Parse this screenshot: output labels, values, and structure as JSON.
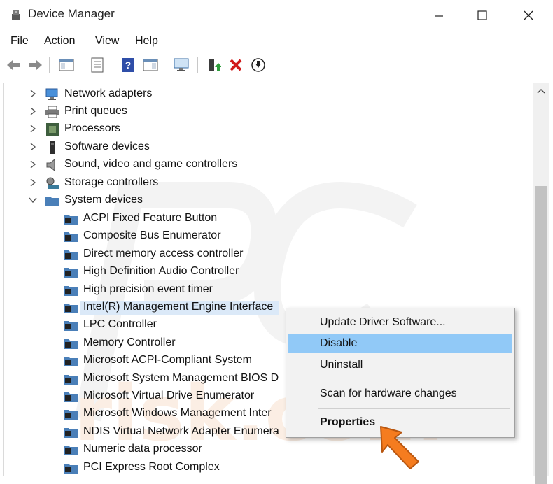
{
  "window": {
    "title": "Device Manager"
  },
  "menubar": {
    "items": [
      "File",
      "Action",
      "View",
      "Help"
    ]
  },
  "toolbar": {
    "buttons": [
      "back-icon",
      "forward-icon",
      "show-hide-console-tree-icon",
      "properties-icon",
      "help-icon",
      "action-pane-icon",
      "monitor-icon",
      "update-driver-icon",
      "uninstall-icon",
      "disable-icon"
    ]
  },
  "tree": {
    "categories": [
      {
        "label": "Network adapters",
        "expanded": false
      },
      {
        "label": "Print queues",
        "expanded": false
      },
      {
        "label": "Processors",
        "expanded": false
      },
      {
        "label": "Software devices",
        "expanded": false
      },
      {
        "label": "Sound, video and game controllers",
        "expanded": false
      },
      {
        "label": "Storage controllers",
        "expanded": false
      },
      {
        "label": "System devices",
        "expanded": true
      }
    ],
    "system_devices": [
      "ACPI Fixed Feature Button",
      "Composite Bus Enumerator",
      "Direct memory access controller",
      "High Definition Audio Controller",
      "High precision event timer",
      "Intel(R) Management Engine Interface",
      "LPC Controller",
      "Memory Controller",
      "Microsoft ACPI-Compliant System",
      "Microsoft System Management BIOS D",
      "Microsoft Virtual Drive Enumerator",
      "Microsoft Windows Management Inter",
      "NDIS Virtual Network Adapter Enumera",
      "Numeric data processor",
      "PCI Express Root Complex"
    ],
    "selected": "Intel(R) Management Engine Interface"
  },
  "context_menu": {
    "items": [
      {
        "label": "Update Driver Software...",
        "highlighted": false,
        "bold": false
      },
      {
        "label": "Disable",
        "highlighted": true,
        "bold": false
      },
      {
        "label": "Uninstall",
        "highlighted": false,
        "bold": false
      },
      {
        "label": "Scan for hardware changes",
        "highlighted": false,
        "bold": false
      },
      {
        "label": "Properties",
        "highlighted": false,
        "bold": true
      }
    ]
  },
  "colors": {
    "selection": "#dbe9f8",
    "menu_highlight": "#91c9f7",
    "arrow": "#f57c1f",
    "disable_red": "#d11a1a"
  }
}
